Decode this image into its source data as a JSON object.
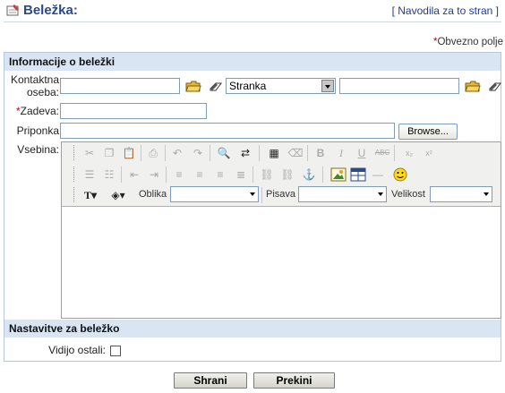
{
  "header": {
    "title": "Beležka:",
    "help_link": "Navodila za to stran"
  },
  "required_note": "Obvezno polje",
  "section_info": {
    "title": "Informacije o beležki"
  },
  "form": {
    "contact_label_line1": "Kontaktna",
    "contact_label_line2": "oseba:",
    "contact_value": "",
    "type_select_value": "Stranka",
    "type_value": "",
    "subject_label": "Zadeva:",
    "subject_value": "",
    "attachment_label": "Priponka",
    "attachment_value": "",
    "browse_label": "Browse...",
    "content_label": "Vsebina:"
  },
  "editor": {
    "format_label": "Oblika",
    "font_label": "Pisava",
    "size_label": "Velikost",
    "format_value": "",
    "font_value": "",
    "size_value": ""
  },
  "section_settings": {
    "title": "Nastavitve za beležko",
    "visible_label": "Vidijo ostali:",
    "visible_checked": false
  },
  "buttons": {
    "save": "Shrani",
    "cancel": "Prekini"
  }
}
